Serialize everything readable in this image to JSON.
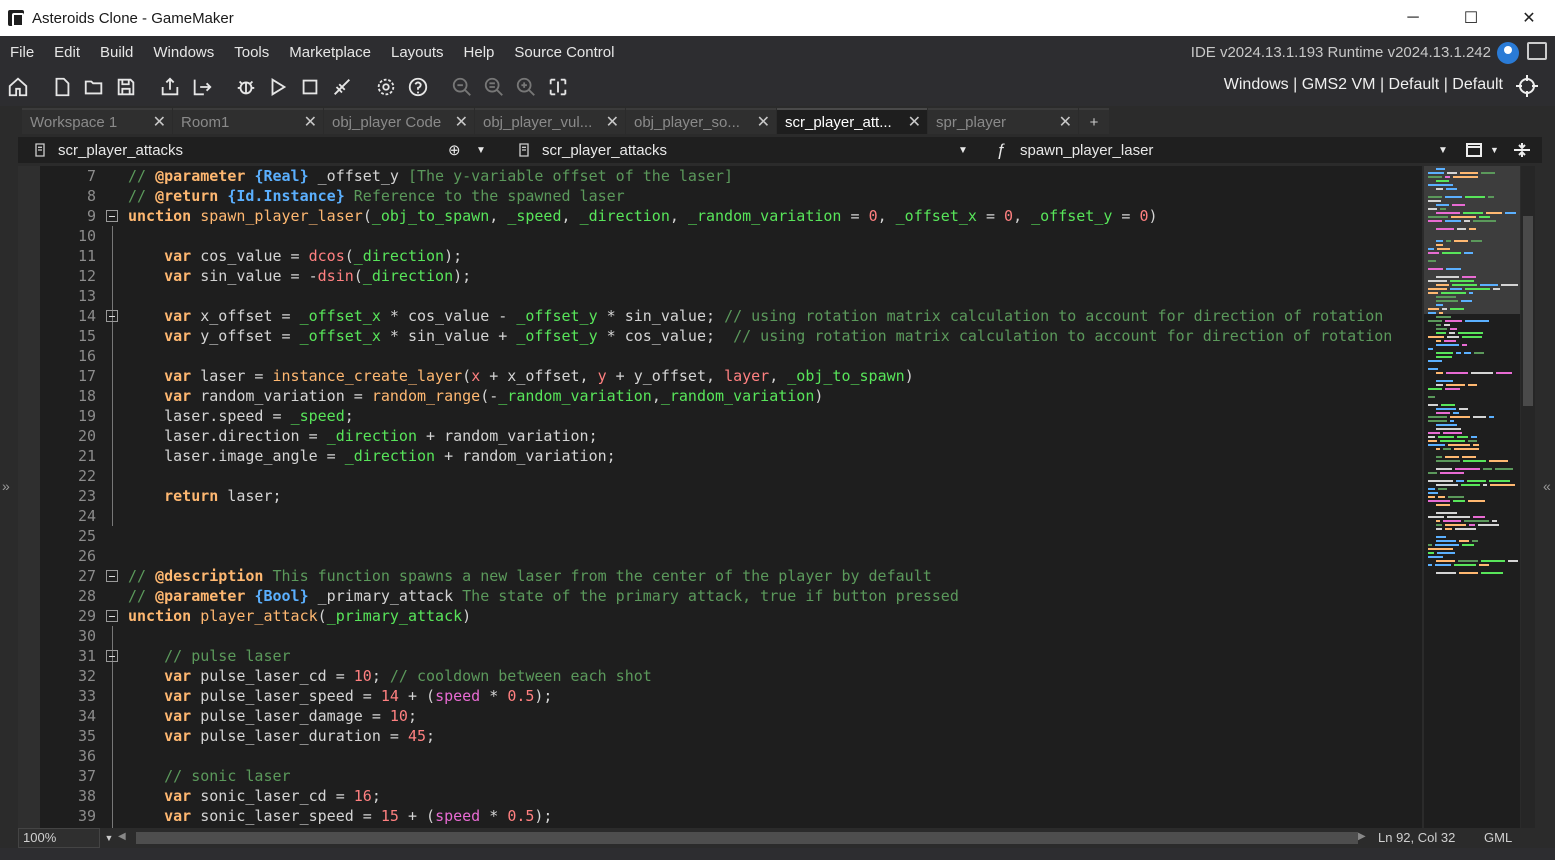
{
  "window": {
    "title": "Asteroids Clone - GameMaker",
    "minimize": "─",
    "maximize": "☐",
    "close": "✕"
  },
  "menu": [
    "File",
    "Edit",
    "Build",
    "Windows",
    "Tools",
    "Marketplace",
    "Layouts",
    "Help",
    "Source Control"
  ],
  "version": "IDE v2024.13.1.193  Runtime v2024.13.1.242",
  "target": "Windows | GMS2 VM | Default | Default",
  "tabs": [
    {
      "label": "Workspace 1",
      "active": false
    },
    {
      "label": "Room1",
      "active": false
    },
    {
      "label": "obj_player Code",
      "active": false
    },
    {
      "label": "obj_player_vul...",
      "active": false
    },
    {
      "label": "obj_player_so...",
      "active": false
    },
    {
      "label": "scr_player_att...",
      "active": true
    },
    {
      "label": "spr_player",
      "active": false
    }
  ],
  "add_tab": "+",
  "editor_header": {
    "script_name": "scr_player_attacks",
    "script_selector": "scr_player_attacks",
    "function_selector": "spawn_player_laser",
    "func_glyph": "ƒ"
  },
  "code_lines": [
    {
      "n": "7",
      "fold": false,
      "html": "<span class='cm'>// </span><span class='tag'>@parameter</span> <span class='ty'>{Real}</span> <span class='plain'>_offset_y</span><span class='cm'> [The y-variable offset of the laser]</span>"
    },
    {
      "n": "8",
      "fold": false,
      "html": "<span class='cm'>// </span><span class='tag'>@return</span> <span class='ty'>{Id.Instance}</span><span class='cm'> Reference to the spawned laser</span>"
    },
    {
      "n": "9",
      "fold": true,
      "html": "<span class='kw'>unction</span> <span class='fn'>spawn_player_laser</span>(<span class='var'>_obj_to_spawn</span>, <span class='var'>_speed</span>, <span class='var'>_direction</span>, <span class='var'>_random_variation</span> = <span class='num'>0</span>, <span class='var'>_offset_x</span> = <span class='num'>0</span>, <span class='var'>_offset_y</span> = <span class='num'>0</span>)"
    },
    {
      "n": "10",
      "fold": false,
      "html": ""
    },
    {
      "n": "11",
      "fold": false,
      "html": "    <span class='kw'>var</span> cos_value = <span class='bi'>dcos</span>(<span class='var'>_direction</span>);"
    },
    {
      "n": "12",
      "fold": false,
      "html": "    <span class='kw'>var</span> sin_value = -<span class='bi'>dsin</span>(<span class='var'>_direction</span>);"
    },
    {
      "n": "13",
      "fold": false,
      "html": ""
    },
    {
      "n": "14",
      "fold": true,
      "html": "    <span class='kw'>var</span> x_offset = <span class='var'>_offset_x</span> * cos_value - <span class='var'>_offset_y</span> * sin_value; <span class='cm'>// using rotation matrix calculation to account for direction of rotation</span>"
    },
    {
      "n": "15",
      "fold": false,
      "html": "    <span class='kw'>var</span> y_offset = <span class='var'>_offset_x</span> * sin_value + <span class='var'>_offset_y</span> * cos_value;  <span class='cm'>// using rotation matrix calculation to account for direction of rotation</span>"
    },
    {
      "n": "16",
      "fold": false,
      "html": ""
    },
    {
      "n": "17",
      "fold": false,
      "html": "    <span class='kw'>var</span> laser = <span class='fn'>instance_create_layer</span>(<span class='bi'>x</span> + x_offset, <span class='bi'>y</span> + y_offset, <span class='bi'>layer</span>, <span class='var'>_obj_to_spawn</span>)"
    },
    {
      "n": "18",
      "fold": false,
      "html": "    <span class='kw'>var</span> random_variation = <span class='fn'>random_range</span>(-<span class='var'>_random_variation</span>,<span class='var'>_random_variation</span>)"
    },
    {
      "n": "19",
      "fold": false,
      "html": "    laser.<span class='plain'>speed</span> = <span class='var'>_speed</span>;"
    },
    {
      "n": "20",
      "fold": false,
      "html": "    laser.<span class='plain'>direction</span> = <span class='var'>_direction</span> + random_variation;"
    },
    {
      "n": "21",
      "fold": false,
      "html": "    laser.<span class='plain'>image_angle</span> = <span class='var'>_direction</span> + random_variation;"
    },
    {
      "n": "22",
      "fold": false,
      "html": ""
    },
    {
      "n": "23",
      "fold": false,
      "html": "    <span class='kw'>return</span> laser;"
    },
    {
      "n": "24",
      "fold": false,
      "html": ""
    },
    {
      "n": "25",
      "fold": false,
      "html": ""
    },
    {
      "n": "26",
      "fold": false,
      "html": ""
    },
    {
      "n": "27",
      "fold": true,
      "html": "<span class='cm'>// </span><span class='tag'>@description</span><span class='cm'> This function spawns a new laser from the center of the player by default</span>"
    },
    {
      "n": "28",
      "fold": false,
      "html": "<span class='cm'>// </span><span class='tag'>@parameter</span> <span class='ty'>{Bool}</span> <span class='plain'>_primary_attack</span><span class='cm'> The state of the primary attack, true if button pressed</span>"
    },
    {
      "n": "29",
      "fold": true,
      "html": "<span class='kw'>unction</span> <span class='fn'>player_attack</span>(<span class='var'>_primary_attack</span>)"
    },
    {
      "n": "30",
      "fold": false,
      "html": ""
    },
    {
      "n": "31",
      "fold": true,
      "html": "    <span class='cm'>// pulse laser</span>"
    },
    {
      "n": "32",
      "fold": false,
      "html": "    <span class='kw'>var</span> pulse_laser_cd = <span class='num'>10</span>; <span class='cm'>// cooldown between each shot</span>"
    },
    {
      "n": "33",
      "fold": false,
      "html": "    <span class='kw'>var</span> pulse_laser_speed = <span class='num'>14</span> + (<span class='pk'>speed</span> * <span class='num'>0.5</span>);"
    },
    {
      "n": "34",
      "fold": false,
      "html": "    <span class='kw'>var</span> pulse_laser_damage = <span class='num'>10</span>;"
    },
    {
      "n": "35",
      "fold": false,
      "html": "    <span class='kw'>var</span> pulse_laser_duration = <span class='num'>45</span>;"
    },
    {
      "n": "36",
      "fold": false,
      "html": ""
    },
    {
      "n": "37",
      "fold": false,
      "html": "    <span class='cm'>// sonic laser</span>"
    },
    {
      "n": "38",
      "fold": false,
      "html": "    <span class='kw'>var</span> sonic_laser_cd = <span class='num'>16</span>;"
    },
    {
      "n": "39",
      "fold": false,
      "html": "    <span class='kw'>var</span> sonic_laser_speed = <span class='num'>15</span> + (<span class='pk'>speed</span> * <span class='num'>0.5</span>);"
    }
  ],
  "status": {
    "zoom": "100%",
    "cursor": "Ln 92, Col 32",
    "language": "GML"
  },
  "colors": {
    "keyword": "#ffb871",
    "comment": "#5b995b",
    "type": "#5bb0ff",
    "local_var": "#58e55a",
    "number": "#ff8080",
    "builtin_var": "#e86bd3"
  }
}
